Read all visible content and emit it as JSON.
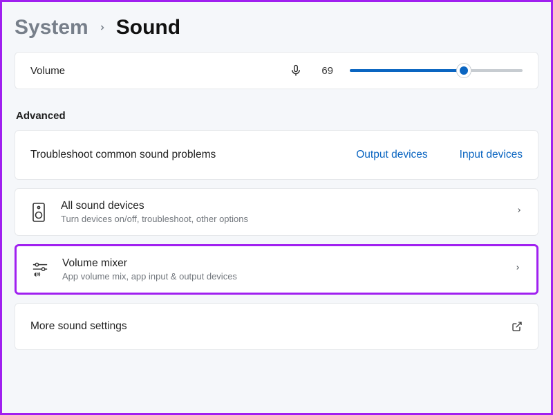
{
  "breadcrumb": {
    "parent": "System",
    "current": "Sound"
  },
  "volume": {
    "label": "Volume",
    "value": "69"
  },
  "advanced": {
    "heading": "Advanced",
    "troubleshoot": {
      "label": "Troubleshoot common sound problems",
      "output_link": "Output devices",
      "input_link": "Input devices"
    },
    "all_devices": {
      "title": "All sound devices",
      "subtitle": "Turn devices on/off, troubleshoot, other options"
    },
    "volume_mixer": {
      "title": "Volume mixer",
      "subtitle": "App volume mix, app input & output devices"
    },
    "more": {
      "label": "More sound settings"
    }
  }
}
